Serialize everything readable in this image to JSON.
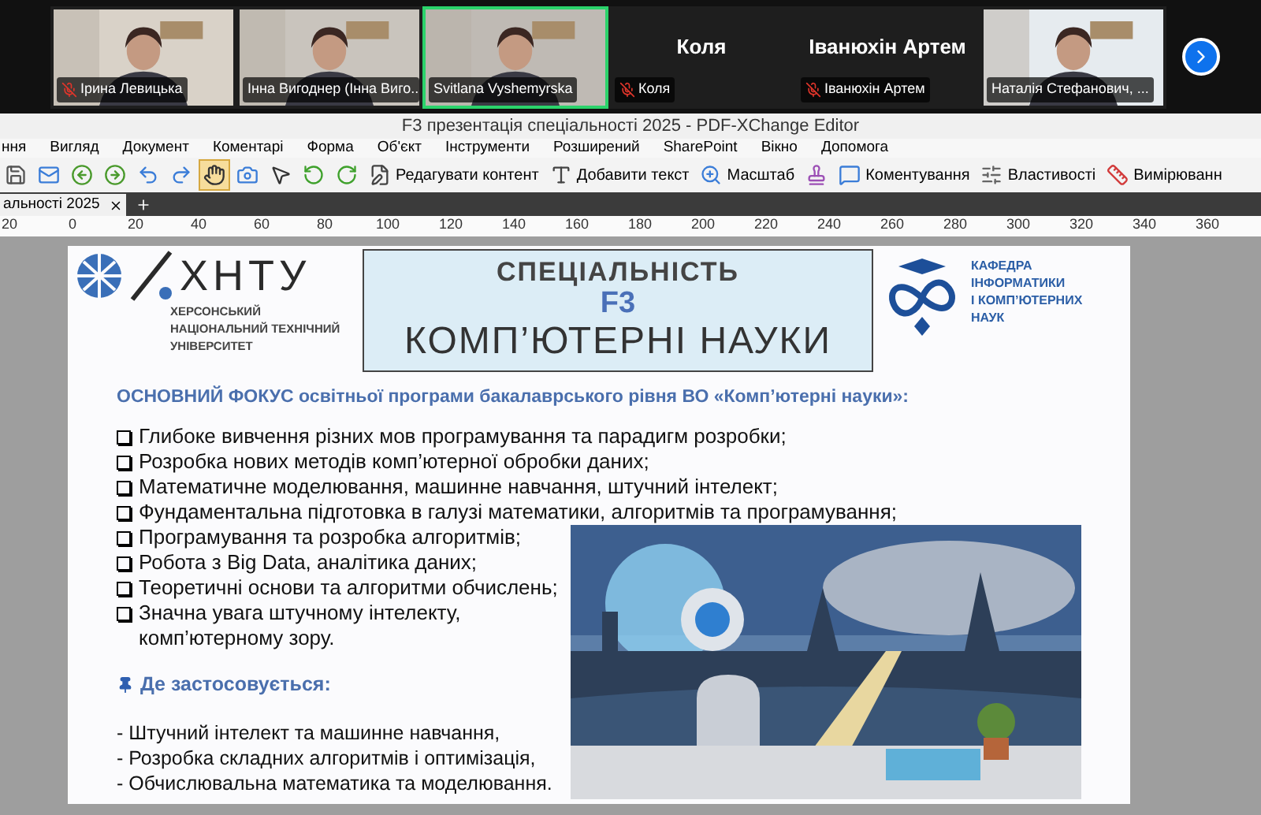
{
  "meeting": {
    "participants": [
      {
        "name": "Ірина Левицька",
        "kind": "video",
        "muted": true,
        "speaking": false
      },
      {
        "name": "Інна Вигоднер (Інна Виго...",
        "kind": "video",
        "muted": false,
        "speaking": false
      },
      {
        "name": "Svitlana Vyshemyrska",
        "kind": "video",
        "muted": false,
        "speaking": true
      },
      {
        "name": "Коля",
        "kind": "name",
        "display_name": "Коля",
        "muted": true,
        "speaking": false
      },
      {
        "name": "Іванюхін Артем",
        "kind": "name",
        "display_name": "Іванюхін Артем",
        "muted": true,
        "speaking": false
      },
      {
        "name": "Наталія Стефанович, ...",
        "kind": "video",
        "muted": false,
        "speaking": false
      }
    ]
  },
  "window": {
    "title": "F3 презентація спеціальності 2025 - PDF-XChange Editor"
  },
  "menu": [
    "ння",
    "Вигляд",
    "Документ",
    "Коментарі",
    "Форма",
    "Об'єкт",
    "Інструменти",
    "Розширений",
    "SharePoint",
    "Вікно",
    "Допомога"
  ],
  "toolbar": [
    {
      "kind": "icon"
    },
    {
      "kind": "icon"
    },
    {
      "kind": "icon"
    },
    {
      "kind": "icon"
    },
    {
      "kind": "icon"
    },
    {
      "kind": "icon"
    },
    {
      "kind": "icon",
      "selected": true
    },
    {
      "kind": "icon",
      "selected": false
    },
    {
      "kind": "icon",
      "selected": false
    },
    {
      "kind": "icon"
    },
    {
      "kind": "icon"
    },
    {
      "kind": "text",
      "label": "Редагувати контент"
    },
    {
      "kind": "text",
      "label": "Добавити текст"
    },
    {
      "kind": "text",
      "label": "Масштаб"
    },
    {
      "kind": "icon"
    },
    {
      "kind": "text",
      "label": "Коментування"
    },
    {
      "kind": "text",
      "label": "Властивості"
    },
    {
      "kind": "text",
      "label": "Вимірюванн"
    }
  ],
  "tabs": [
    {
      "label": "альності 2025",
      "selected": true
    }
  ],
  "ruler": [
    "20",
    "0",
    "20",
    "40",
    "60",
    "80",
    "100",
    "120",
    "140",
    "160",
    "180",
    "200",
    "220",
    "240",
    "260",
    "280",
    "300",
    "320",
    "340",
    "360"
  ],
  "slide": {
    "logo": {
      "mark": "ХНТУ",
      "lines": [
        "ХЕРСОНСЬКИЙ",
        "НАЦІОНАЛЬНИЙ ТЕХНІЧНИЙ",
        "УНІВЕРСИТЕТ"
      ]
    },
    "title": [
      "СПЕЦІАЛЬНІСТЬ",
      "F3",
      "КОМП’ЮТЕРНІ НАУКИ"
    ],
    "department": [
      "КАФЕДРА",
      "ІНФОРМАТИКИ",
      "І КОМП’ЮТЕРНИХ",
      "НАУК"
    ],
    "focus": "ОСНОВНИЙ ФОКУС освітньої програми бакалаврського рівня ВО «Комп’ютерні науки»:",
    "focus_items": [
      "Глибоке вивчення різних мов програмування та парадигм розробки;",
      "Розробка нових методів комп’ютерної обробки даних;",
      "Математичне моделювання, машинне навчання, штучний інтелект;",
      "Фундаментальна підготовка в галузі математики, алгоритмів та програмування;",
      "Програмування та розробка алгоритмів;",
      "Робота з Big Data, аналітика даних;",
      "Теоретичні основи та алгоритми обчислень;",
      "Значна увага штучному інтелекту, комп’ютерному зору."
    ],
    "applications_heading": "Де застосовується:",
    "applications": [
      "- Штучний інтелект та машинне навчання,",
      "- Розробка складних алгоритмів і оптимізація,",
      "- Обчислювальна математика та моделювання."
    ],
    "image": {
      "kind": "picture"
    }
  }
}
